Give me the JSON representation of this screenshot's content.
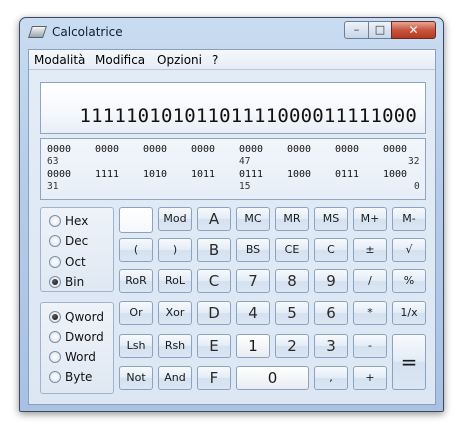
{
  "window": {
    "title": "Calcolatrice",
    "controls": {
      "minimize": "–",
      "maximize": "□",
      "close": "✕"
    }
  },
  "menu": [
    "Modalità",
    "Modifica",
    "Opzioni",
    "?"
  ],
  "display": {
    "value": "11111010101101111000011111000"
  },
  "bits": {
    "row1": [
      "0000",
      "0000",
      "0000",
      "0000",
      "0000",
      "0000",
      "0000",
      "0000"
    ],
    "row1_labels": [
      "63",
      "47",
      "32"
    ],
    "row2": [
      "0000",
      "1111",
      "1010",
      "1011",
      "0111",
      "1000",
      "0111",
      "1000"
    ],
    "row2_labels": [
      "31",
      "15",
      "0"
    ]
  },
  "base": {
    "options": [
      "Hex",
      "Dec",
      "Oct",
      "Bin"
    ],
    "selected": "Bin"
  },
  "word": {
    "options": [
      "Qword",
      "Dword",
      "Word",
      "Byte"
    ],
    "selected": "Qword"
  },
  "buttons": {
    "row1": [
      "",
      "Mod",
      "A",
      "MC",
      "MR",
      "MS",
      "M+",
      "M-"
    ],
    "row2": [
      "(",
      ")",
      "B",
      "BS",
      "CE",
      "C",
      "±",
      "√"
    ],
    "row3": [
      "RoR",
      "RoL",
      "C",
      "7",
      "8",
      "9",
      "/",
      "%"
    ],
    "row4": [
      "Or",
      "Xor",
      "D",
      "4",
      "5",
      "6",
      "*",
      "1/x"
    ],
    "row5": [
      "Lsh",
      "Rsh",
      "E",
      "1",
      "2",
      "3",
      "-"
    ],
    "row6": [
      "Not",
      "And",
      "F",
      "0",
      ",",
      "+"
    ],
    "equals": "="
  }
}
